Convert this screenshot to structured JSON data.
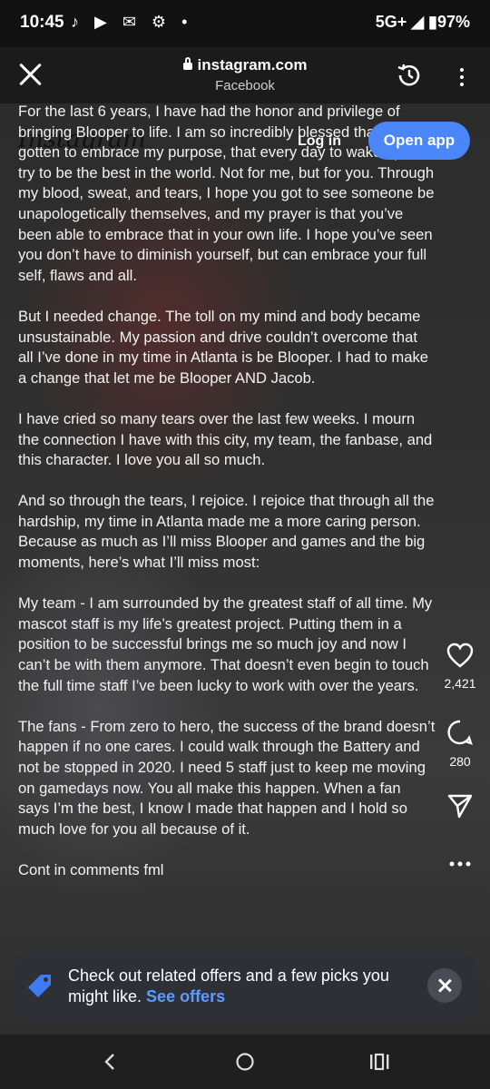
{
  "status_bar": {
    "time": "10:45",
    "left_icons": "♪ ▶ ✉ ⚙ •",
    "right": "5G+ ◢ ▮97%"
  },
  "browser": {
    "url": "instagram.com",
    "subtitle": "Facebook"
  },
  "instagram": {
    "logo": "Instagram",
    "login": "Log in",
    "open_app": "Open app"
  },
  "caption": {
    "paragraphs": [
      "For the last 6 years, I have had the honor and privilege of bringing Blooper to life. I am so incredibly blessed that I’ve gotten to embrace my purpose, that every day to wake up and try to be the best in the world. Not for me, but for you. Through my blood, sweat, and tears, I hope you got to see someone be unapologetically themselves, and my prayer is that you’ve been able to embrace that in your own life. I hope you’ve seen you don’t have to diminish yourself, but can embrace your full self, flaws and all.",
      "But I needed change. The toll on my mind and body became unsustainable. My passion and drive couldn’t overcome that all I’ve done in my time in Atlanta is be Blooper. I had to make a change that let me be Blooper AND Jacob.",
      "I have cried so many tears over the last few weeks. I mourn the connection I have with this city, my team, the fanbase, and this character. I love you all so much.",
      "And so through the tears, I rejoice. I rejoice that through all the hardship, my time in Atlanta made me a more caring person. Because as much as I’ll miss Blooper and games and the big moments, here’s what I’ll miss most:",
      "My team - I am surrounded by the greatest staff of all time. My mascot staff is my life’s greatest project. Putting them in a position to be successful brings me so much joy and now I can’t be with them anymore. That doesn’t even begin to touch the full time staff I’ve been lucky to work with over the years.",
      "The fans - From zero to hero, the success of the brand doesn’t happen if no one cares. I could walk through the Battery and not be stopped in 2020. I need 5 staff just to keep me moving on gamedays now. You all make this happen. When a fan says I’m the best, I know I made that happen and I hold so much love for you all because of it.",
      "Cont in comments fml"
    ]
  },
  "actions": {
    "likes": "2,421",
    "comments": "280"
  },
  "offer": {
    "text": "Check out related offers and a few picks you might like.",
    "link": "See offers"
  }
}
